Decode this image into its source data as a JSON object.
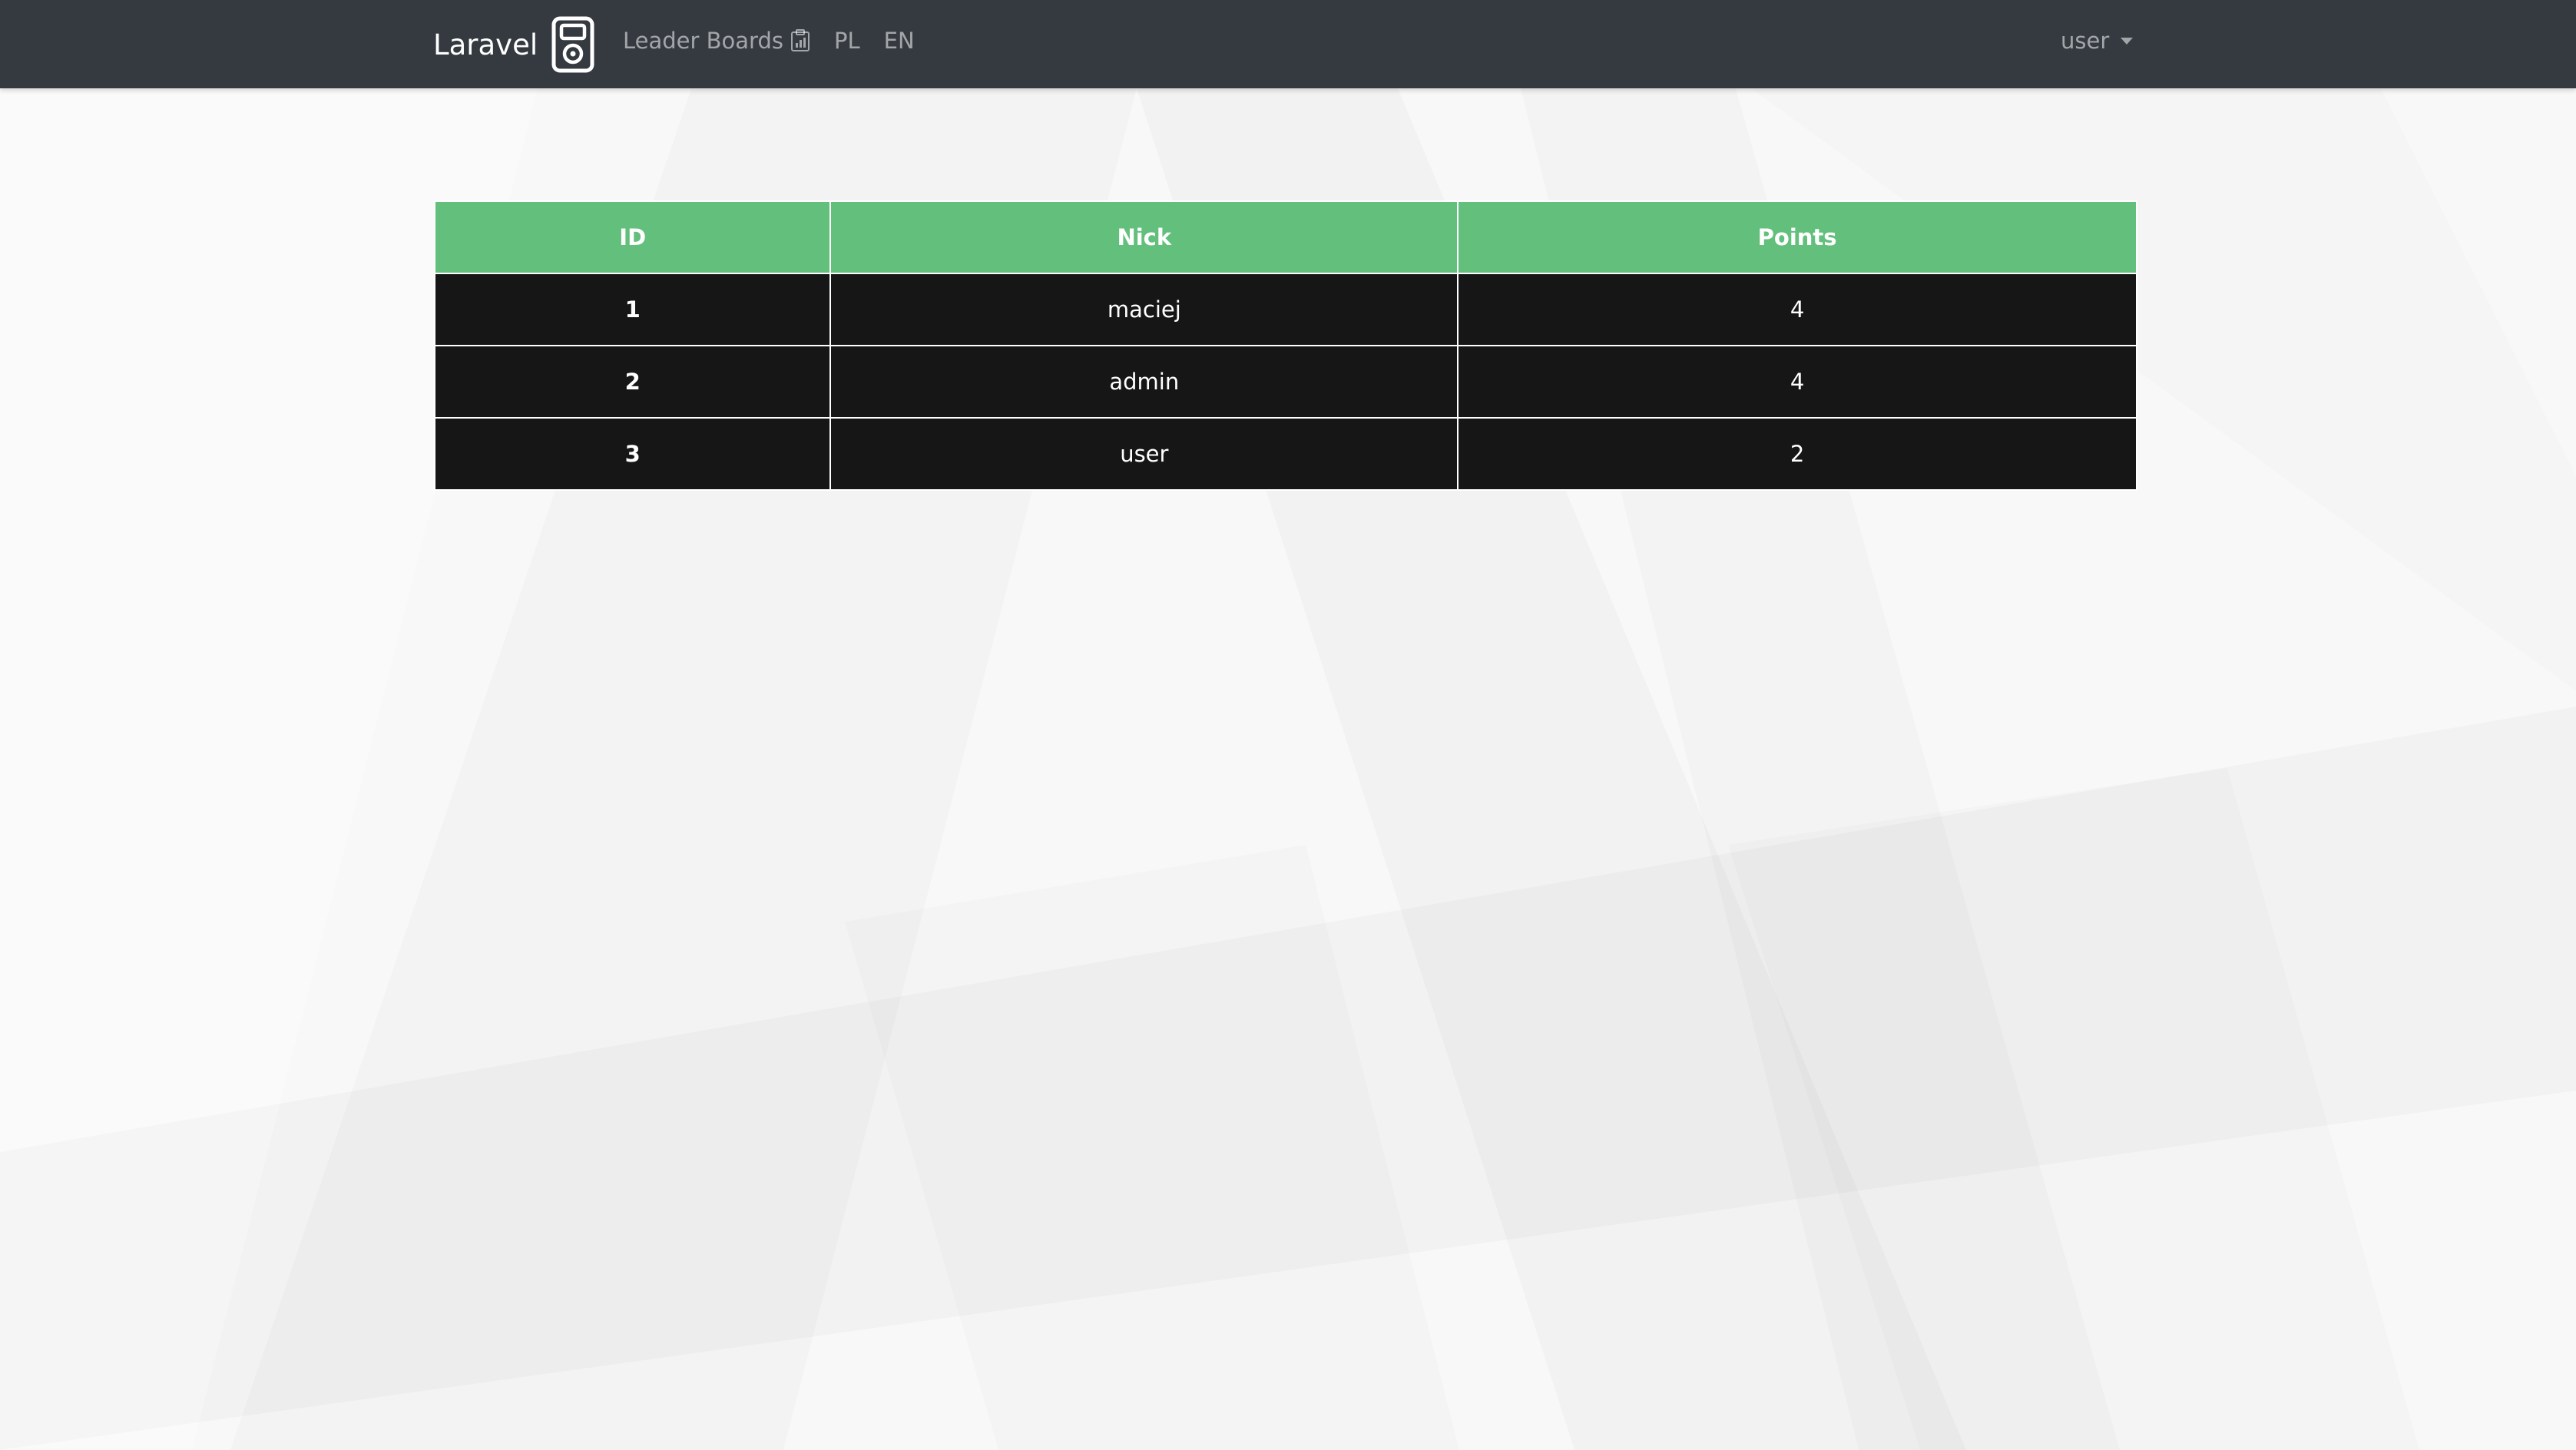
{
  "navbar": {
    "brand": "Laravel",
    "brand_logo_icon": "music-player-icon",
    "links": [
      {
        "label": "Leader Boards",
        "icon": "clipboard-chart-icon"
      },
      {
        "label": "PL"
      },
      {
        "label": "EN"
      }
    ],
    "user_menu": {
      "label": "user",
      "icon": "caret-down-icon"
    }
  },
  "leaderboard": {
    "header_color": "#63bf7c",
    "row_color": "#161616",
    "columns": [
      "ID",
      "Nick",
      "Points"
    ],
    "rows": [
      {
        "id": "1",
        "nick": "maciej",
        "points": "4"
      },
      {
        "id": "2",
        "nick": "admin",
        "points": "4"
      },
      {
        "id": "3",
        "nick": "user",
        "points": "2"
      }
    ]
  }
}
